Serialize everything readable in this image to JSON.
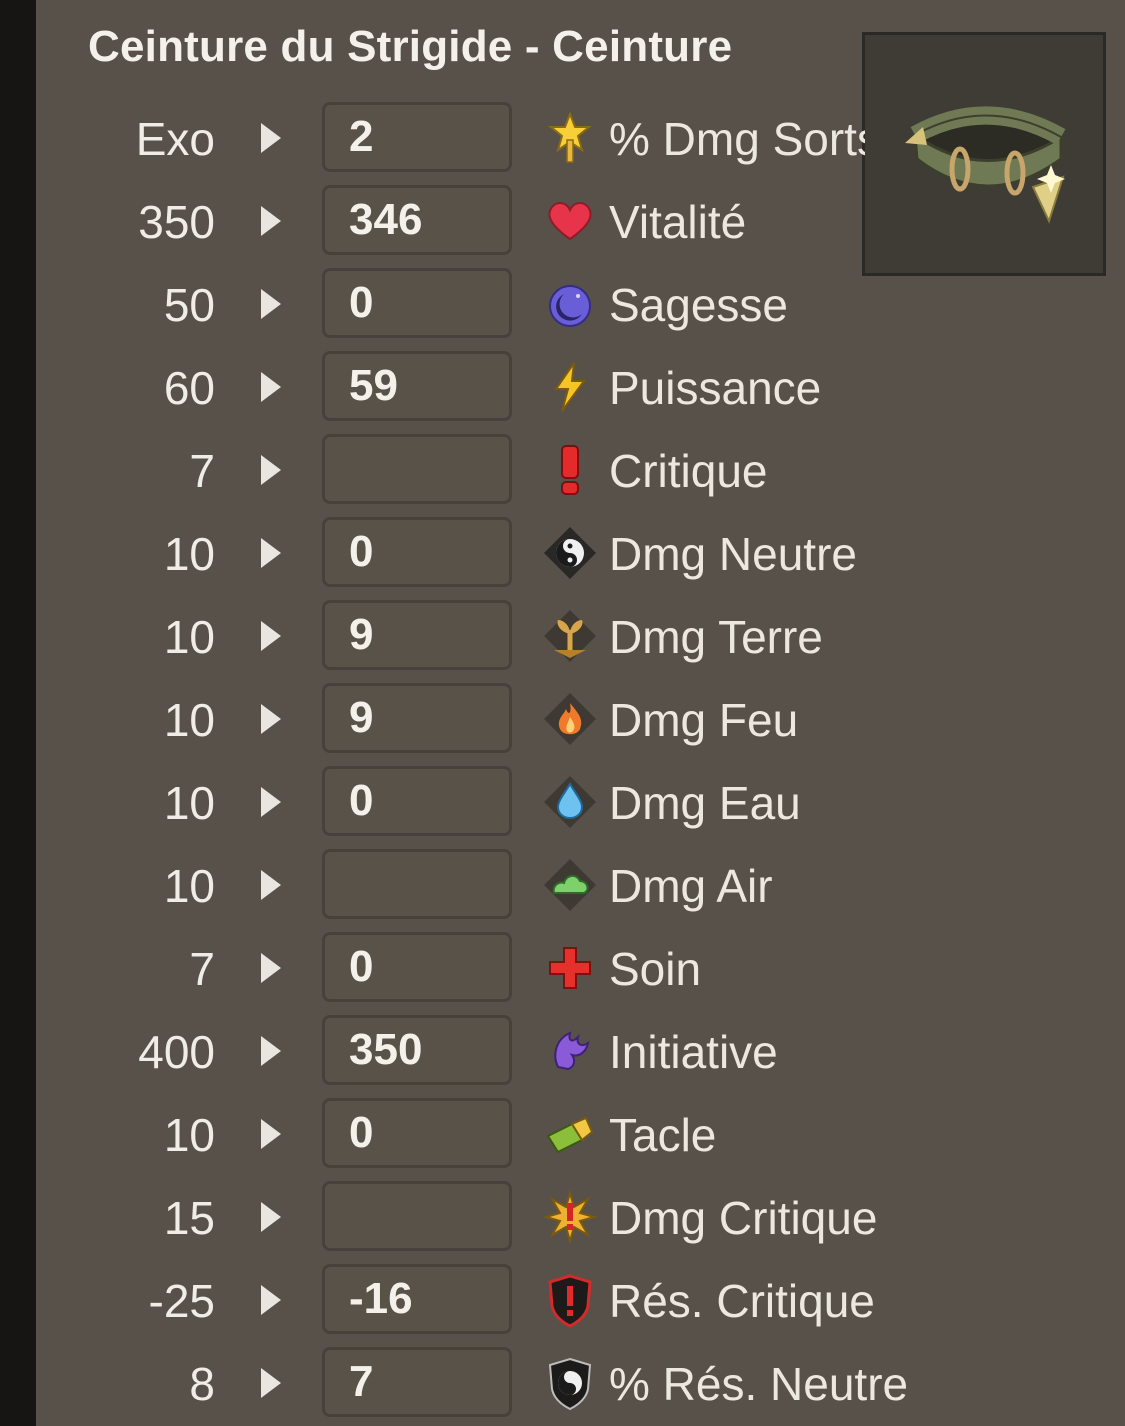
{
  "title": "Ceinture du Strigide - Ceinture",
  "rows": [
    {
      "max": "Exo",
      "value": "2",
      "label": "% Dmg Sorts",
      "icon": "star-arrow-icon"
    },
    {
      "max": "350",
      "value": "346",
      "label": "Vitalité",
      "icon": "heart-icon"
    },
    {
      "max": "50",
      "value": "0",
      "label": "Sagesse",
      "icon": "moon-icon"
    },
    {
      "max": "60",
      "value": "59",
      "label": "Puissance",
      "icon": "lightning-icon"
    },
    {
      "max": "7",
      "value": "",
      "label": "Critique",
      "icon": "exclamation-icon"
    },
    {
      "max": "10",
      "value": "0",
      "label": "Dmg Neutre",
      "icon": "yin-yang-icon"
    },
    {
      "max": "10",
      "value": "9",
      "label": "Dmg Terre",
      "icon": "earth-sprout-icon"
    },
    {
      "max": "10",
      "value": "9",
      "label": "Dmg Feu",
      "icon": "fire-icon"
    },
    {
      "max": "10",
      "value": "0",
      "label": "Dmg Eau",
      "icon": "water-drop-icon"
    },
    {
      "max": "10",
      "value": "",
      "label": "Dmg Air",
      "icon": "cloud-icon"
    },
    {
      "max": "7",
      "value": "0",
      "label": "Soin",
      "icon": "red-cross-icon"
    },
    {
      "max": "400",
      "value": "350",
      "label": "Initiative",
      "icon": "initiative-icon"
    },
    {
      "max": "10",
      "value": "0",
      "label": "Tacle",
      "icon": "tackle-icon"
    },
    {
      "max": "15",
      "value": "",
      "label": "Dmg Critique",
      "icon": "critical-burst-icon"
    },
    {
      "max": "-25",
      "value": "-16",
      "label": "Rés. Critique",
      "icon": "shield-exclamation-icon"
    },
    {
      "max": "8",
      "value": "7",
      "label": "% Rés. Neutre",
      "icon": "yin-yang-shield-icon"
    }
  ],
  "item_image": "belt-icon"
}
